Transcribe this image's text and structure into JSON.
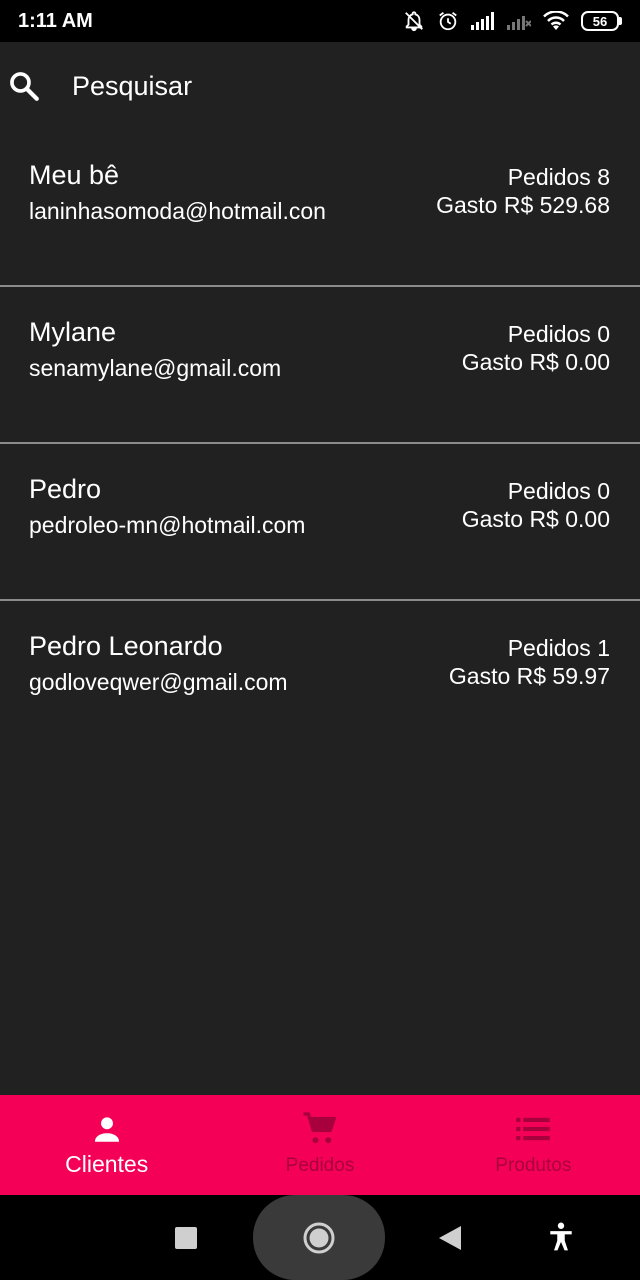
{
  "status_bar": {
    "time": "1:11 AM",
    "battery": "56",
    "icons": [
      "mute-icon",
      "alarm-icon",
      "signal-icon",
      "signal-icon",
      "wifi-icon",
      "battery-icon"
    ]
  },
  "search": {
    "placeholder": "Pesquisar",
    "icon": "search-icon"
  },
  "clients": [
    {
      "name": "Meu bê",
      "email": "laninhasomoda@hotmail.con",
      "orders": "Pedidos 8",
      "spent": "Gasto R$ 529.68"
    },
    {
      "name": "Mylane",
      "email": "senamylane@gmail.com",
      "orders": "Pedidos 0",
      "spent": "Gasto R$ 0.00"
    },
    {
      "name": "Pedro",
      "email": "pedroleo-mn@hotmail.com",
      "orders": "Pedidos 0",
      "spent": "Gasto R$ 0.00"
    },
    {
      "name": "Pedro Leonardo",
      "email": "godloveqwer@gmail.com",
      "orders": "Pedidos 1",
      "spent": "Gasto R$ 59.97"
    }
  ],
  "bottom_nav": {
    "items": [
      {
        "label": "Clientes",
        "icon": "person-icon",
        "active": true
      },
      {
        "label": "Pedidos",
        "icon": "cart-icon",
        "active": false
      },
      {
        "label": "Produtos",
        "icon": "list-icon",
        "active": false
      }
    ]
  },
  "colors": {
    "background": "#212121",
    "accent": "#f50057",
    "inactive_nav": "#a8003c",
    "divider": "#8c8c8c"
  }
}
